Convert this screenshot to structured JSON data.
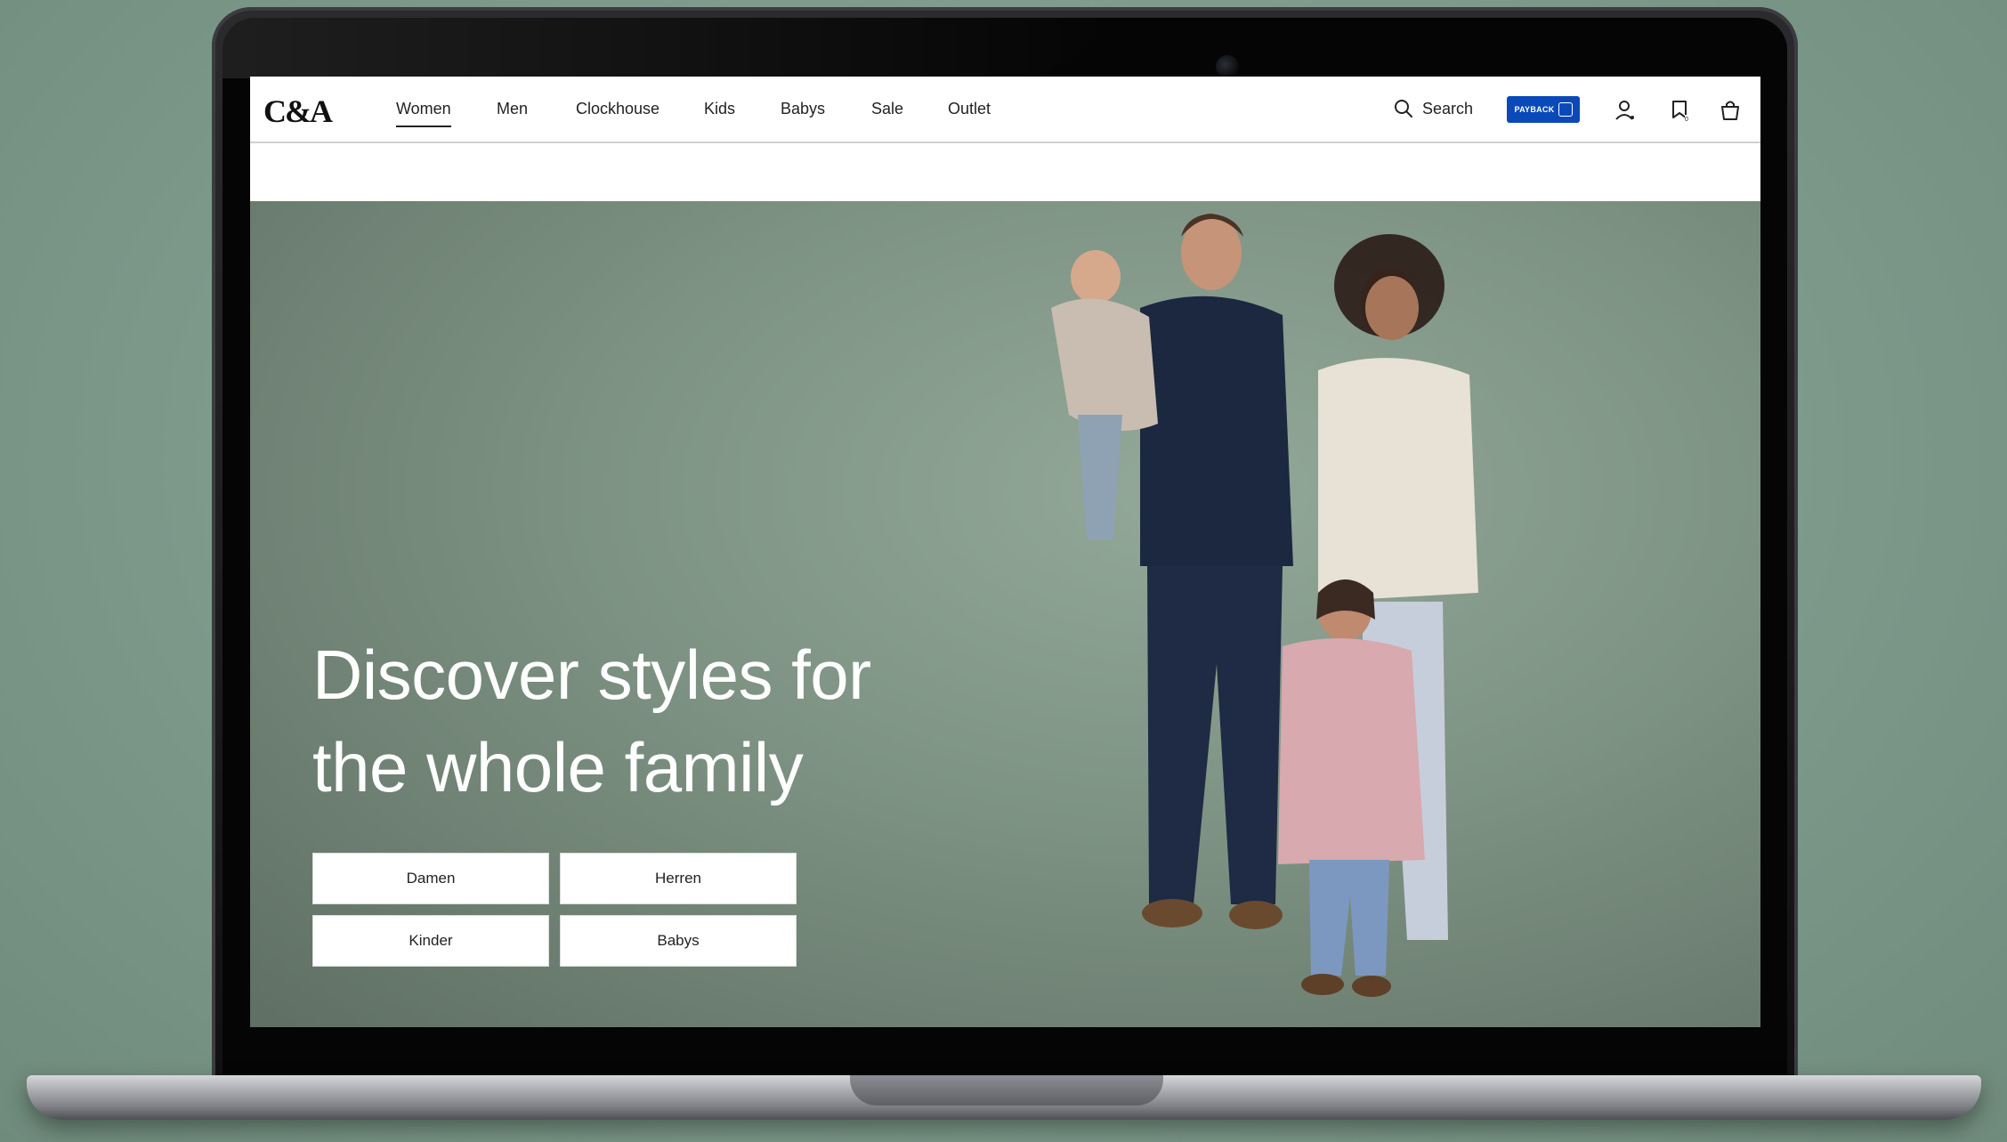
{
  "brand": {
    "logo_text": "C&A"
  },
  "nav": {
    "items": [
      "Women",
      "Men",
      "Clockhouse",
      "Kids",
      "Babys",
      "Sale",
      "Outlet"
    ],
    "active": "Women",
    "search_label": "Search",
    "payback_label": "PAYBACK"
  },
  "icons": {
    "search": "search-icon",
    "account": "user-icon",
    "wishlist": "wishlist-icon",
    "cart": "shopping-bag-icon"
  },
  "hero": {
    "headline_line1": "Discover styles for",
    "headline_line2": "the whole family",
    "buttons": [
      "Damen",
      "Herren",
      "Kinder",
      "Babys"
    ]
  },
  "colors": {
    "payback_blue": "#0a49b8",
    "hero_background": "#7d9283",
    "page_background": "#7e9a8b"
  }
}
